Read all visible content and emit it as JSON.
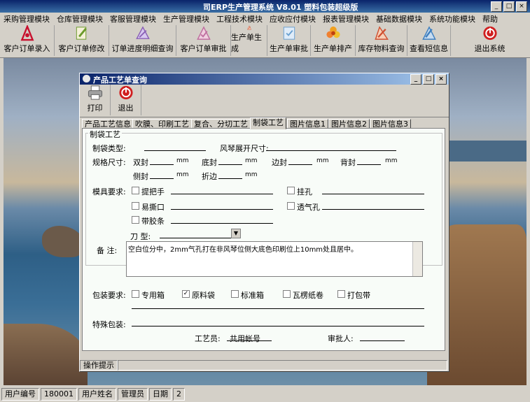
{
  "window": {
    "title": "司ERP生产管理系统  V8.01  塑料包装超级版",
    "controls": [
      "_",
      "□",
      "×"
    ]
  },
  "menu": [
    "采购管理模块",
    "仓库管理模块",
    "客服管理模块",
    "生产管理模块",
    "工程技术模块",
    "应收应付模块",
    "报表管理模块",
    "基础数据模块",
    "系统功能模块",
    "帮助"
  ],
  "toolbar": [
    {
      "label": "客户订单录入",
      "icon": "pdf-icon",
      "color": "#c8102e"
    },
    {
      "label": "客户订单修改",
      "icon": "edit-icon",
      "color": "#6a9a2a"
    },
    {
      "label": "订单进度明细查询",
      "icon": "query-icon",
      "color": "#8a5fb5"
    },
    {
      "label": "客户订单审批",
      "icon": "approve-icon",
      "color": "#c070a0"
    },
    {
      "label": "生产单生成",
      "icon": "generate-icon",
      "color": "#c84020"
    },
    {
      "label": "生产单审批",
      "icon": "check-icon",
      "color": "#6aa0d0"
    },
    {
      "label": "生产单排产",
      "icon": "flower-icon",
      "color": "#f0a020"
    },
    {
      "label": "库存物料查询",
      "icon": "inventory-icon",
      "color": "#d05030"
    },
    {
      "label": "查看短信息",
      "icon": "message-icon",
      "color": "#4080c0"
    },
    {
      "label": "退出系统",
      "icon": "exit-icon",
      "color": "#d02020"
    }
  ],
  "child": {
    "title": "产品工艺单查询",
    "tools": [
      {
        "label": "打印",
        "icon": "printer-icon"
      },
      {
        "label": "退出",
        "icon": "exit-icon"
      }
    ],
    "tabs": [
      "产品工艺信息",
      "吹膜、印刷工艺",
      "复合、分切工艺",
      "制袋工艺",
      "图片信息1",
      "图片信息2",
      "图片信息3"
    ],
    "active_tab": 3,
    "group_title": "制袋工艺",
    "bag_type_label": "制袋类型:",
    "fold_label": "风琴展开尺寸:",
    "spec_label": "规格尺寸:",
    "dims": [
      {
        "label": "双封",
        "unit": "mm"
      },
      {
        "label": "底封",
        "unit": "mm"
      },
      {
        "label": "边封",
        "unit": "mm"
      },
      {
        "label": "背封",
        "unit": "mm"
      },
      {
        "label": "侧封",
        "unit": "mm"
      },
      {
        "label": "折边",
        "unit": "mm"
      }
    ],
    "mold_label": "模具要求:",
    "mold_options": [
      "提把手",
      "挂孔",
      "易撕口",
      "透气孔",
      "带胶条"
    ],
    "blade_label": "刀 型:",
    "remark_label": "备 注:",
    "remark_text": "空白位分中，2mm气孔打在非风琴位侧大底色印刷位上10mm处且居中。",
    "pack_label": "包装要求:",
    "pack_options": [
      {
        "label": "专用箱",
        "checked": false
      },
      {
        "label": "原料袋",
        "checked": true
      },
      {
        "label": "标准箱",
        "checked": false
      },
      {
        "label": "瓦楞纸卷",
        "checked": false
      },
      {
        "label": "打包带",
        "checked": false
      }
    ],
    "special_label": "特殊包装:",
    "craft_label": "工艺员:",
    "craft_value": "共用帐号",
    "approver_label": "审批人:",
    "status": "操作提示"
  },
  "status": {
    "user_code_label": "用户编号",
    "user_code": "180001",
    "user_name_label": "用户姓名",
    "user_name": "管理员",
    "date_label": "日期",
    "date_value": "2"
  }
}
